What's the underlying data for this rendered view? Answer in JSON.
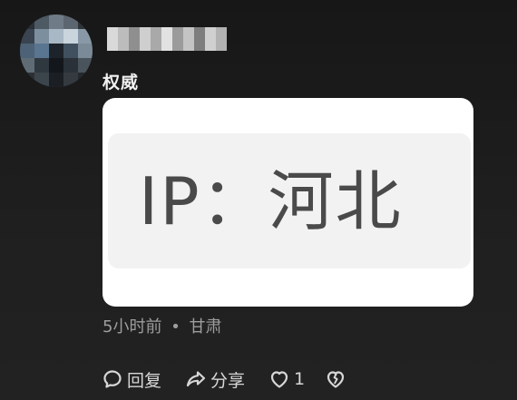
{
  "comment": {
    "author_hidden": true,
    "text": "权威",
    "ip_image_text": "IP：河北",
    "time": "5小时前",
    "separator": "•",
    "location": "甘肃"
  },
  "actions": {
    "reply_label": "回复",
    "share_label": "分享",
    "like_count": "1"
  },
  "colors": {
    "background": "#1c1c1c",
    "text_primary": "#f1f1f1",
    "text_secondary": "#9d9d9d",
    "image_card_bg": "#ffffff",
    "ip_box_bg": "#f2f2f2",
    "ip_text": "#4a4a4a"
  },
  "icons": {
    "reply": "speech-bubble-icon",
    "share": "share-arrow-icon",
    "like": "heart-icon",
    "dislike": "broken-heart-icon"
  }
}
